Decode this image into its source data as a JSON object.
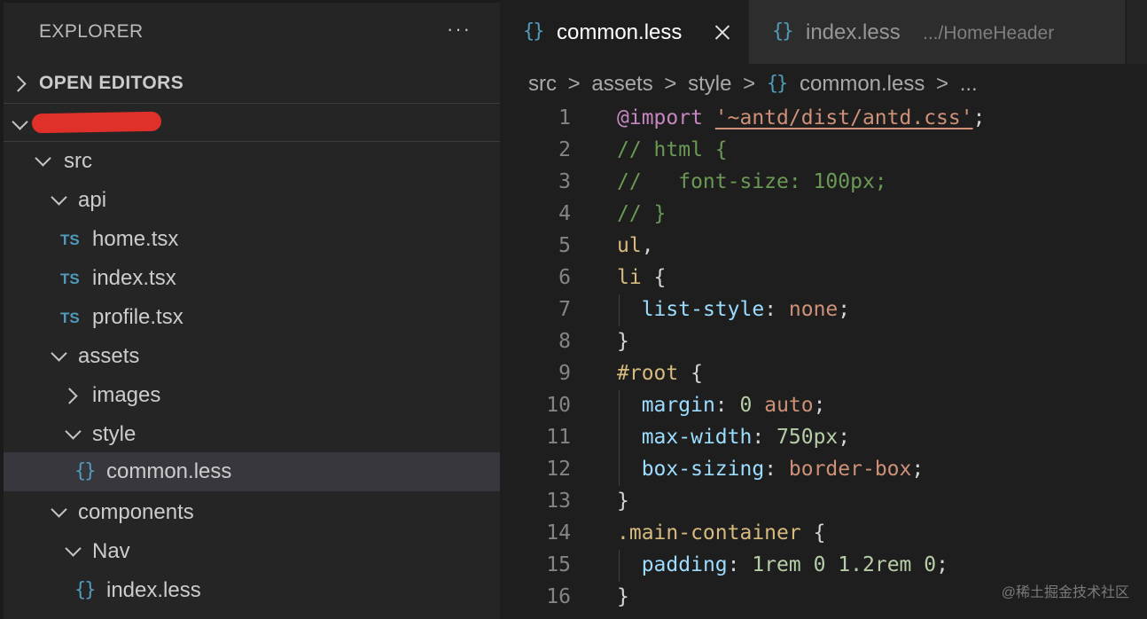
{
  "sidebar": {
    "title": "EXPLORER",
    "more": "···",
    "open_editors": "OPEN EDITORS",
    "tree": [
      {
        "name": "src"
      },
      {
        "name": "api"
      },
      {
        "name": "home.tsx",
        "badge": "TS"
      },
      {
        "name": "index.tsx",
        "badge": "TS"
      },
      {
        "name": "profile.tsx",
        "badge": "TS"
      },
      {
        "name": "assets"
      },
      {
        "name": "images"
      },
      {
        "name": "style"
      },
      {
        "name": "common.less",
        "badge": "{}"
      },
      {
        "name": "components"
      },
      {
        "name": "Nav"
      },
      {
        "name": "index.less",
        "badge": "{}"
      }
    ]
  },
  "tabs": [
    {
      "icon": "{}",
      "name": "common.less",
      "active": true
    },
    {
      "icon": "{}",
      "name": "index.less",
      "description": ".../HomeHeader",
      "active": false
    }
  ],
  "breadcrumb": {
    "parts": [
      "src",
      "assets",
      "style",
      "common.less",
      "..."
    ],
    "file_icon": "{}",
    "separator": ">"
  },
  "code": [
    {
      "n": "1",
      "tokens": [
        [
          "at",
          "@import"
        ],
        [
          "pun",
          " "
        ],
        [
          "str",
          "'~antd/dist/antd.css'"
        ],
        [
          "pun",
          ";"
        ]
      ]
    },
    {
      "n": "2",
      "tokens": [
        [
          "cmt",
          "// html {"
        ]
      ]
    },
    {
      "n": "3",
      "tokens": [
        [
          "cmt",
          "//   font-size: 100px;"
        ]
      ]
    },
    {
      "n": "4",
      "tokens": [
        [
          "cmt",
          "// }"
        ]
      ]
    },
    {
      "n": "5",
      "tokens": [
        [
          "tag",
          "ul"
        ],
        [
          "pun",
          ","
        ]
      ]
    },
    {
      "n": "6",
      "tokens": [
        [
          "tag",
          "li"
        ],
        [
          "pun",
          " {"
        ]
      ]
    },
    {
      "n": "7",
      "tokens": [
        [
          "pun",
          "  "
        ],
        [
          "prop",
          "list-style"
        ],
        [
          "pun",
          ": "
        ],
        [
          "val",
          "none"
        ],
        [
          "pun",
          ";"
        ]
      ]
    },
    {
      "n": "8",
      "tokens": [
        [
          "pun",
          "}"
        ]
      ]
    },
    {
      "n": "9",
      "tokens": [
        [
          "tag",
          "#root"
        ],
        [
          "pun",
          " {"
        ]
      ]
    },
    {
      "n": "10",
      "tokens": [
        [
          "pun",
          "  "
        ],
        [
          "prop",
          "margin"
        ],
        [
          "pun",
          ": "
        ],
        [
          "num",
          "0"
        ],
        [
          "pun",
          " "
        ],
        [
          "val",
          "auto"
        ],
        [
          "pun",
          ";"
        ]
      ]
    },
    {
      "n": "11",
      "tokens": [
        [
          "pun",
          "  "
        ],
        [
          "prop",
          "max-width"
        ],
        [
          "pun",
          ": "
        ],
        [
          "num",
          "750px"
        ],
        [
          "pun",
          ";"
        ]
      ]
    },
    {
      "n": "12",
      "tokens": [
        [
          "pun",
          "  "
        ],
        [
          "prop",
          "box-sizing"
        ],
        [
          "pun",
          ": "
        ],
        [
          "val",
          "border-box"
        ],
        [
          "pun",
          ";"
        ]
      ]
    },
    {
      "n": "13",
      "tokens": [
        [
          "pun",
          "}"
        ]
      ]
    },
    {
      "n": "14",
      "tokens": [
        [
          "tag",
          ".main-container"
        ],
        [
          "pun",
          " {"
        ]
      ]
    },
    {
      "n": "15",
      "tokens": [
        [
          "pun",
          "  "
        ],
        [
          "prop",
          "padding"
        ],
        [
          "pun",
          ": "
        ],
        [
          "num",
          "1rem"
        ],
        [
          "pun",
          " "
        ],
        [
          "num",
          "0"
        ],
        [
          "pun",
          " "
        ],
        [
          "num",
          "1.2rem"
        ],
        [
          "pun",
          " "
        ],
        [
          "num",
          "0"
        ],
        [
          "pun",
          ";"
        ]
      ]
    },
    {
      "n": "16",
      "tokens": [
        [
          "pun",
          "}"
        ]
      ]
    }
  ],
  "watermark": "@稀土掘金技术社区"
}
